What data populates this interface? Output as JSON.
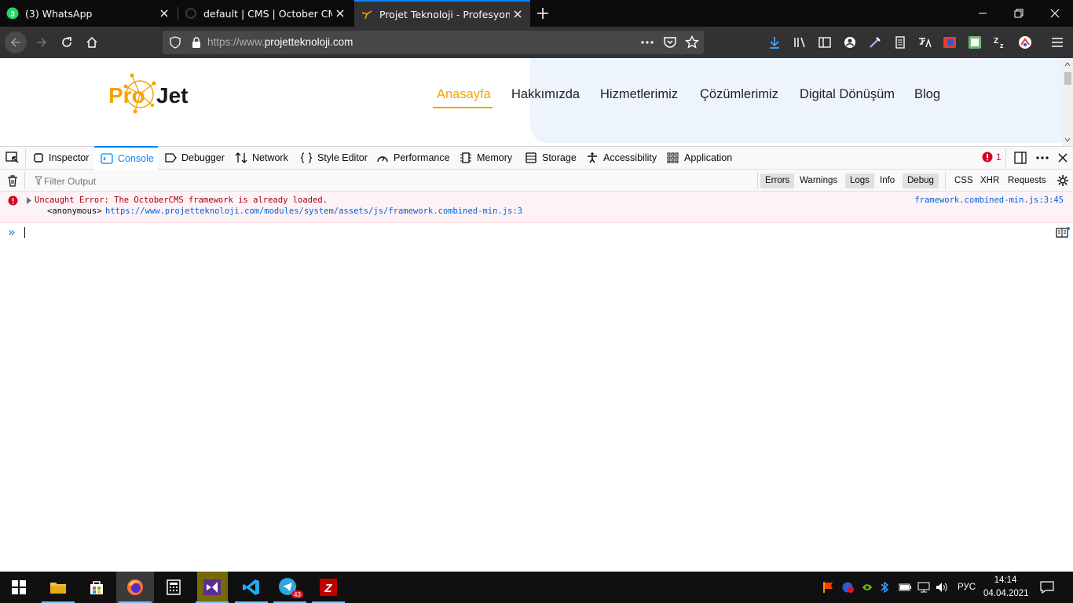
{
  "browser": {
    "tabs": [
      {
        "title": "(3) WhatsApp",
        "badge": "3",
        "icon": "whatsapp-icon"
      },
      {
        "title": "default | CMS | October CMS",
        "icon": "octobercms-icon"
      },
      {
        "title": "Projet Teknoloji - Profesyonel, I",
        "icon": "projet-favicon",
        "selected": true
      }
    ],
    "url_prefix": "https://www.",
    "url_domain": "projetteknoloji.com"
  },
  "site": {
    "logo_text_left": "Pro",
    "logo_text_right": "Jet",
    "nav": [
      "Anasayfa",
      "Hakkımızda",
      "Hizmetlerimiz",
      "Çözümlerimiz",
      "Digital Dönüşüm",
      "Blog"
    ],
    "active_nav": "Anasayfa",
    "accent": "#f5a300"
  },
  "devtools": {
    "tabs": [
      "Inspector",
      "Console",
      "Debugger",
      "Network",
      "Style Editor",
      "Performance",
      "Memory",
      "Storage",
      "Accessibility",
      "Application"
    ],
    "selected_tab": "Console",
    "error_count": "1",
    "filter_placeholder": "Filter Output",
    "filters": [
      "Errors",
      "Warnings",
      "Logs",
      "Info",
      "Debug"
    ],
    "filters_on": [
      "Errors",
      "Logs",
      "Debug"
    ],
    "net_filters": [
      "CSS",
      "XHR",
      "Requests"
    ],
    "error": {
      "message": "Uncaught Error: The OctoberCMS framework is already loaded.",
      "frame": "<anonymous>",
      "url": "https://www.projetteknoloji.com/modules/system/assets/js/framework.combined-min.js:3",
      "source": "framework.combined-min.js:3:45"
    },
    "prompt": "»"
  },
  "taskbar": {
    "telegram_badge": "43",
    "lang": "РУС",
    "time": "14:14",
    "date": "04.04.2021"
  }
}
